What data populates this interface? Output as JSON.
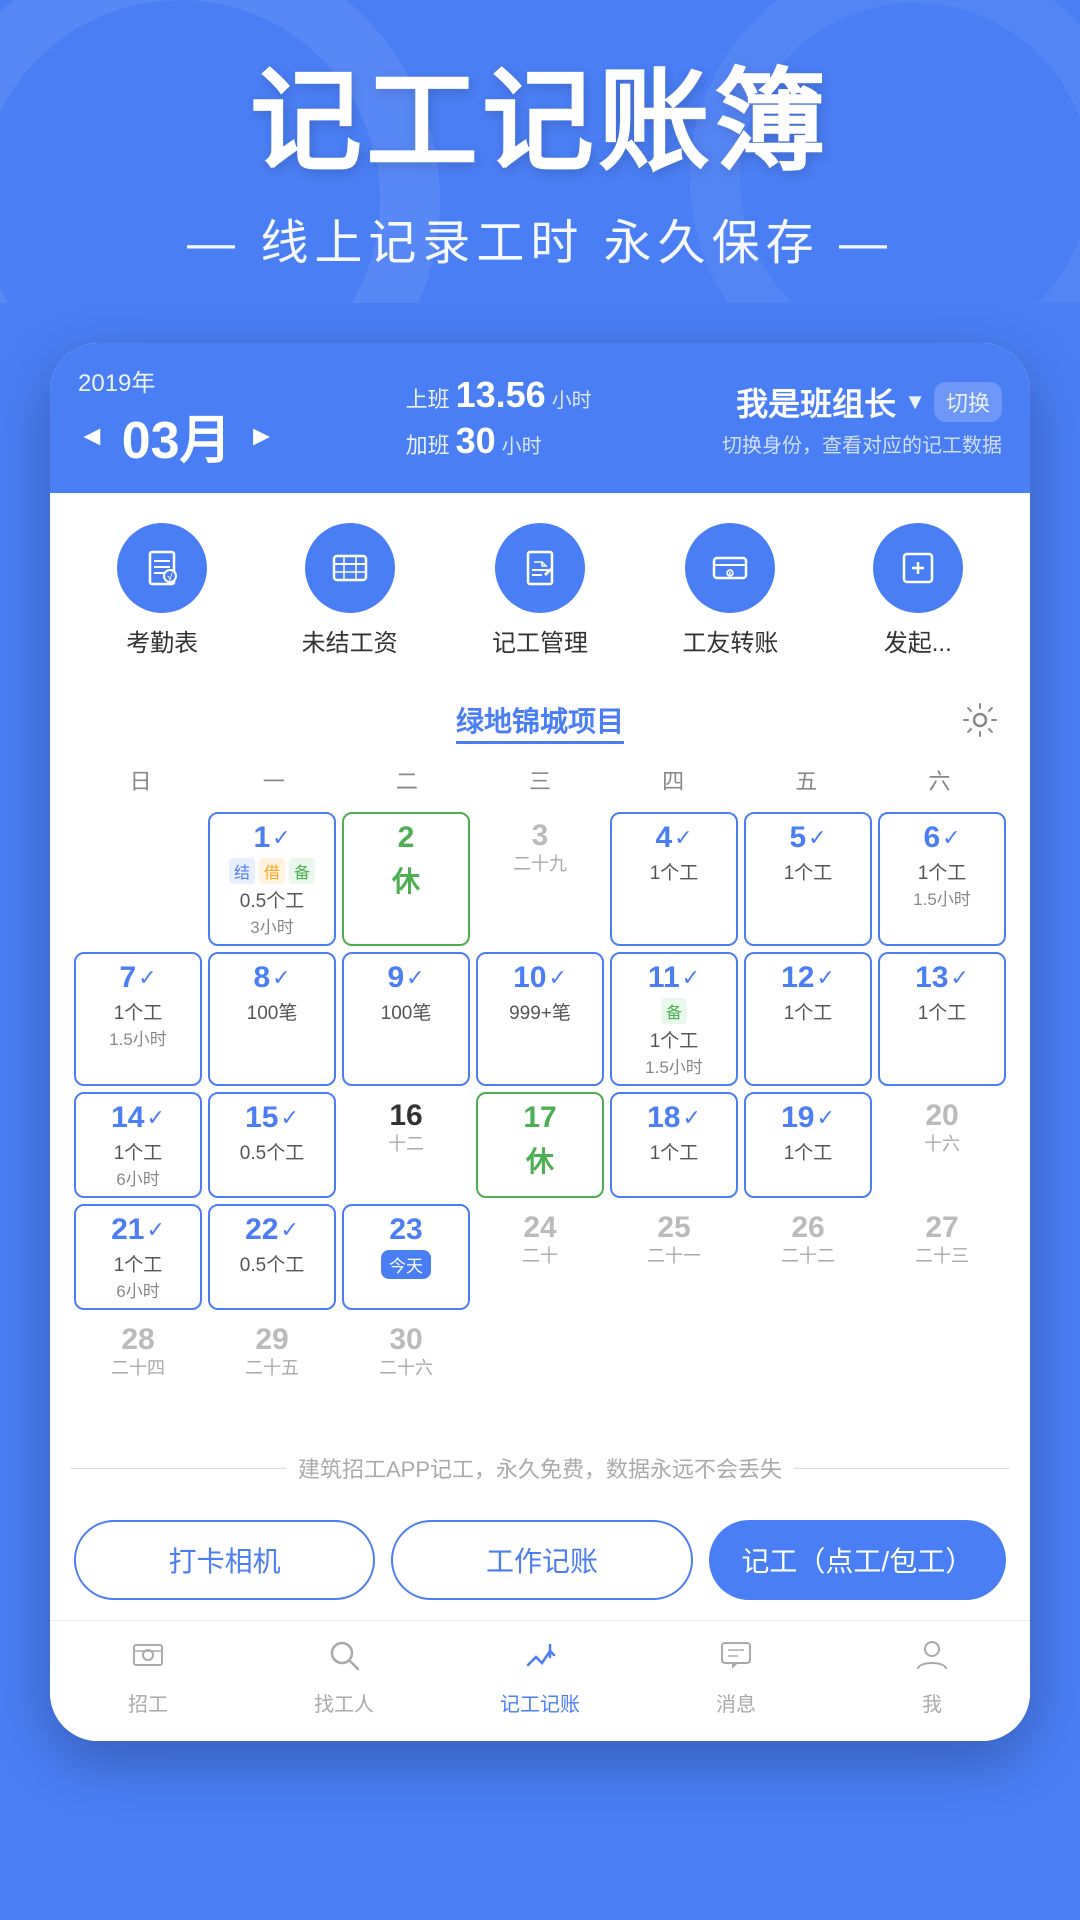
{
  "header": {
    "main_title": "记工记账簿",
    "sub_title": "— 线上记录工时 永久保存 —"
  },
  "app_bar": {
    "year": "2019年",
    "month": "03月",
    "prev_arrow": "◄",
    "next_arrow": "►",
    "work_label": "上班",
    "work_hours": "13.56",
    "work_unit_h": "小",
    "work_unit2": "时",
    "overtime_label": "加班",
    "overtime_hours": "30",
    "overtime_unit": "小时",
    "role": "我是班组长",
    "switch_text": "切换",
    "role_desc": "切换身份，查看对应的记工数据",
    "dropdown": "▼"
  },
  "quick_actions": [
    {
      "id": "kaocheng",
      "icon": "📋",
      "label": "考勤表"
    },
    {
      "id": "weijie",
      "icon": "💴",
      "label": "未结工资"
    },
    {
      "id": "jigong",
      "icon": "📝",
      "label": "记工管理"
    },
    {
      "id": "zhuanzhang",
      "icon": "💳",
      "label": "工友转账"
    },
    {
      "id": "faqi",
      "icon": "📤",
      "label": "发起..."
    }
  ],
  "project": {
    "name": "绿地锦城项目"
  },
  "weekdays": [
    "日",
    "一",
    "二",
    "三",
    "四",
    "五",
    "六"
  ],
  "calendar_rows": [
    [
      {
        "day": "",
        "lunar": "",
        "check": false,
        "tags": [],
        "work": "",
        "overtime": "",
        "rest": false,
        "today": false,
        "border": false,
        "dayColor": "gray"
      },
      {
        "day": "1",
        "lunar": "",
        "check": true,
        "tags": [
          "结",
          "借",
          "备"
        ],
        "work": "0.5个工",
        "overtime": "3小时",
        "rest": false,
        "today": false,
        "border": true,
        "dayColor": "blue"
      },
      {
        "day": "2",
        "lunar": "",
        "check": false,
        "tags": [],
        "work": "",
        "overtime": "",
        "rest": true,
        "today": false,
        "border": true,
        "dayColor": "green",
        "restBorder": true
      },
      {
        "day": "3",
        "lunar": "二十九",
        "check": false,
        "tags": [],
        "work": "",
        "overtime": "",
        "rest": false,
        "today": false,
        "border": false,
        "dayColor": "gray"
      },
      {
        "day": "4",
        "lunar": "",
        "check": true,
        "tags": [],
        "work": "1个工",
        "overtime": "",
        "rest": false,
        "today": false,
        "border": true,
        "dayColor": "blue"
      },
      {
        "day": "5",
        "lunar": "",
        "check": true,
        "tags": [],
        "work": "1个工",
        "overtime": "",
        "rest": false,
        "today": false,
        "border": true,
        "dayColor": "blue"
      },
      {
        "day": "6",
        "lunar": "",
        "check": true,
        "tags": [],
        "work": "1个工",
        "overtime": "1.5小时",
        "rest": false,
        "today": false,
        "border": true,
        "dayColor": "blue"
      }
    ],
    [
      {
        "day": "7",
        "lunar": "",
        "check": true,
        "tags": [],
        "work": "1个工",
        "overtime": "1.5小时",
        "rest": false,
        "today": false,
        "border": true,
        "dayColor": "blue"
      },
      {
        "day": "8",
        "lunar": "",
        "check": true,
        "tags": [],
        "work": "100笔",
        "overtime": "",
        "rest": false,
        "today": false,
        "border": true,
        "dayColor": "blue"
      },
      {
        "day": "9",
        "lunar": "",
        "check": true,
        "tags": [],
        "work": "100笔",
        "overtime": "",
        "rest": false,
        "today": false,
        "border": true,
        "dayColor": "blue"
      },
      {
        "day": "10",
        "lunar": "",
        "check": true,
        "tags": [],
        "work": "999+笔",
        "overtime": "",
        "rest": false,
        "today": false,
        "border": true,
        "dayColor": "blue"
      },
      {
        "day": "11",
        "lunar": "",
        "check": true,
        "tags": [
          "备"
        ],
        "work": "1个工",
        "overtime": "1.5小时",
        "rest": false,
        "today": false,
        "border": true,
        "dayColor": "blue"
      },
      {
        "day": "12",
        "lunar": "",
        "check": true,
        "tags": [],
        "work": "1个工",
        "overtime": "",
        "rest": false,
        "today": false,
        "border": true,
        "dayColor": "blue"
      },
      {
        "day": "13",
        "lunar": "",
        "check": true,
        "tags": [],
        "work": "1个工",
        "overtime": "",
        "rest": false,
        "today": false,
        "border": true,
        "dayColor": "blue"
      }
    ],
    [
      {
        "day": "14",
        "lunar": "",
        "check": true,
        "tags": [],
        "work": "1个工",
        "overtime": "6小时",
        "rest": false,
        "today": false,
        "border": true,
        "dayColor": "blue"
      },
      {
        "day": "15",
        "lunar": "",
        "check": true,
        "tags": [],
        "work": "0.5个工",
        "overtime": "",
        "rest": false,
        "today": false,
        "border": true,
        "dayColor": "blue"
      },
      {
        "day": "16",
        "lunar": "十二",
        "check": false,
        "tags": [],
        "work": "",
        "overtime": "",
        "rest": false,
        "today": false,
        "border": false,
        "dayColor": "black"
      },
      {
        "day": "17",
        "lunar": "",
        "check": false,
        "tags": [],
        "work": "",
        "overtime": "",
        "rest": true,
        "today": false,
        "border": true,
        "dayColor": "green",
        "restBorder": true
      },
      {
        "day": "18",
        "lunar": "",
        "check": true,
        "tags": [],
        "work": "1个工",
        "overtime": "",
        "rest": false,
        "today": false,
        "border": true,
        "dayColor": "blue"
      },
      {
        "day": "19",
        "lunar": "",
        "check": true,
        "tags": [],
        "work": "1个工",
        "overtime": "",
        "rest": false,
        "today": false,
        "border": true,
        "dayColor": "blue"
      },
      {
        "day": "20",
        "lunar": "十六",
        "check": false,
        "tags": [],
        "work": "",
        "overtime": "",
        "rest": false,
        "today": false,
        "border": false,
        "dayColor": "gray"
      }
    ],
    [
      {
        "day": "21",
        "lunar": "",
        "check": true,
        "tags": [],
        "work": "1个工",
        "overtime": "6小时",
        "rest": false,
        "today": false,
        "border": true,
        "dayColor": "blue"
      },
      {
        "day": "22",
        "lunar": "",
        "check": true,
        "tags": [],
        "work": "0.5个工",
        "overtime": "",
        "rest": false,
        "today": false,
        "border": true,
        "dayColor": "blue"
      },
      {
        "day": "23",
        "lunar": "今天",
        "check": false,
        "tags": [],
        "work": "",
        "overtime": "",
        "rest": false,
        "today": true,
        "border": true,
        "dayColor": "blue"
      },
      {
        "day": "24",
        "lunar": "二十",
        "check": false,
        "tags": [],
        "work": "",
        "overtime": "",
        "rest": false,
        "today": false,
        "border": false,
        "dayColor": "gray"
      },
      {
        "day": "25",
        "lunar": "二十一",
        "check": false,
        "tags": [],
        "work": "",
        "overtime": "",
        "rest": false,
        "today": false,
        "border": false,
        "dayColor": "gray"
      },
      {
        "day": "26",
        "lunar": "二十二",
        "check": false,
        "tags": [],
        "work": "",
        "overtime": "",
        "rest": false,
        "today": false,
        "border": false,
        "dayColor": "gray"
      },
      {
        "day": "27",
        "lunar": "二十三",
        "check": false,
        "tags": [],
        "work": "",
        "overtime": "",
        "rest": false,
        "today": false,
        "border": false,
        "dayColor": "gray"
      }
    ],
    [
      {
        "day": "28",
        "lunar": "二十四",
        "check": false,
        "tags": [],
        "work": "",
        "overtime": "",
        "rest": false,
        "today": false,
        "border": false,
        "dayColor": "gray"
      },
      {
        "day": "29",
        "lunar": "二十五",
        "check": false,
        "tags": [],
        "work": "",
        "overtime": "",
        "rest": false,
        "today": false,
        "border": false,
        "dayColor": "gray"
      },
      {
        "day": "30",
        "lunar": "二十六",
        "check": false,
        "tags": [],
        "work": "",
        "overtime": "",
        "rest": false,
        "today": false,
        "border": false,
        "dayColor": "gray"
      },
      {
        "day": "",
        "lunar": "",
        "check": false,
        "tags": [],
        "work": "",
        "overtime": "",
        "rest": false,
        "today": false,
        "border": false,
        "dayColor": "gray"
      },
      {
        "day": "",
        "lunar": "",
        "check": false,
        "tags": [],
        "work": "",
        "overtime": "",
        "rest": false,
        "today": false,
        "border": false,
        "dayColor": "gray"
      },
      {
        "day": "",
        "lunar": "",
        "check": false,
        "tags": [],
        "work": "",
        "overtime": "",
        "rest": false,
        "today": false,
        "border": false,
        "dayColor": "gray"
      },
      {
        "day": "",
        "lunar": "",
        "check": false,
        "tags": [],
        "work": "",
        "overtime": "",
        "rest": false,
        "today": false,
        "border": false,
        "dayColor": "gray"
      }
    ]
  ],
  "footer": {
    "text": "建筑招工APP记工，永久免费，数据永远不会丢失"
  },
  "bottom_buttons": [
    {
      "id": "daka",
      "label": "打卡相机",
      "type": "outline"
    },
    {
      "id": "gongzuojizhan",
      "label": "工作记账",
      "type": "outline"
    },
    {
      "id": "jigong",
      "label": "记工（点工/包工）",
      "type": "filled"
    }
  ],
  "bottom_nav": [
    {
      "id": "zhaogong",
      "icon": "👷",
      "label": "招工",
      "active": false
    },
    {
      "id": "zhaogongren",
      "icon": "🔍",
      "label": "找工人",
      "active": false
    },
    {
      "id": "jigongjizhan",
      "icon": "✏️",
      "label": "记工记账",
      "active": true
    },
    {
      "id": "xiaoxi",
      "icon": "💬",
      "label": "消息",
      "active": false
    },
    {
      "id": "wo",
      "icon": "👤",
      "label": "我",
      "active": false
    }
  ]
}
